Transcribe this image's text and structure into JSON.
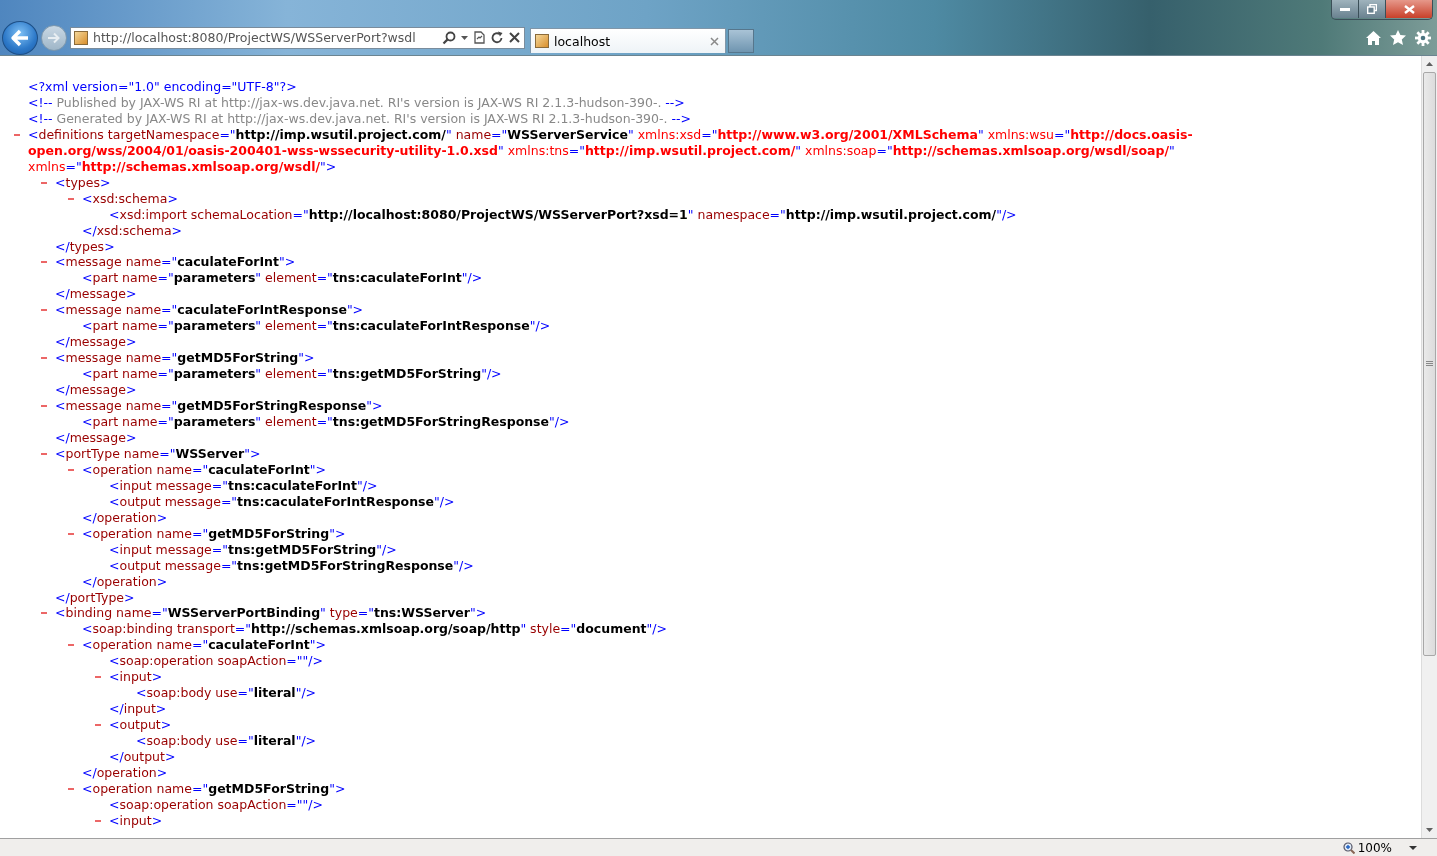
{
  "browser": {
    "address_url": "http://localhost:8080/ProjectWS/WSServerPort?wsdl",
    "tabs": [
      {
        "title": "localhost",
        "selected": true
      }
    ],
    "zoom": "100%"
  },
  "document": [
    {
      "kind": "pi",
      "tokens": [
        {
          "kind": "punct",
          "text": "<?xml version=\"1.0\" encoding=\"UTF-8\"?>"
        }
      ]
    },
    {
      "kind": "comment",
      "tokens": [
        {
          "kind": "punct",
          "text": "<!--"
        },
        {
          "kind": "comment",
          "text": " Published by JAX-WS RI at http://jax-ws.dev.java.net. RI's version is JAX-WS RI 2.1.3-hudson-390-. "
        },
        {
          "kind": "punct",
          "text": "-->"
        }
      ]
    },
    {
      "kind": "comment",
      "tokens": [
        {
          "kind": "punct",
          "text": "<!--"
        },
        {
          "kind": "comment",
          "text": " Generated by JAX-WS RI at http://jax-ws.dev.java.net. RI's version is JAX-WS RI 2.1.3-hudson-390-. "
        },
        {
          "kind": "punct",
          "text": "-->"
        }
      ]
    },
    {
      "kind": "element",
      "expanded": true,
      "tokens": [
        {
          "kind": "punct",
          "text": "<"
        },
        {
          "kind": "tag",
          "text": "definitions"
        },
        {
          "kind": "attr",
          "text": " targetNamespace"
        },
        {
          "kind": "punct",
          "text": "=\""
        },
        {
          "kind": "value",
          "text": "http://imp.wsutil.project.com/"
        },
        {
          "kind": "punct",
          "text": "\""
        },
        {
          "kind": "attr",
          "text": " name"
        },
        {
          "kind": "punct",
          "text": "=\""
        },
        {
          "kind": "value",
          "text": "WSServerService"
        },
        {
          "kind": "punct",
          "text": "\""
        },
        {
          "kind": "nsattr",
          "text": " xmlns:xsd"
        },
        {
          "kind": "punct",
          "text": "=\""
        },
        {
          "kind": "nsvalue",
          "text": "http://www.w3.org/2001/XMLSchema"
        },
        {
          "kind": "punct",
          "text": "\""
        },
        {
          "kind": "nsattr",
          "text": " xmlns:wsu"
        },
        {
          "kind": "punct",
          "text": "=\""
        },
        {
          "kind": "nsvalue",
          "text": "http://docs.oasis-open.org/wss/2004/01/oasis-200401-wss-wssecurity-utility-1.0.xsd"
        },
        {
          "kind": "punct",
          "text": "\""
        },
        {
          "kind": "nsattr",
          "text": " xmlns:tns"
        },
        {
          "kind": "punct",
          "text": "=\""
        },
        {
          "kind": "nsvalue",
          "text": "http://imp.wsutil.project.com/"
        },
        {
          "kind": "punct",
          "text": "\""
        },
        {
          "kind": "nsattr",
          "text": " xmlns:soap"
        },
        {
          "kind": "punct",
          "text": "=\""
        },
        {
          "kind": "nsvalue",
          "text": "http://schemas.xmlsoap.org/wsdl/soap/"
        },
        {
          "kind": "punct",
          "text": "\""
        },
        {
          "kind": "nsattr",
          "text": " xmlns"
        },
        {
          "kind": "punct",
          "text": "=\""
        },
        {
          "kind": "nsvalue",
          "text": "http://schemas.xmlsoap.org/wsdl/"
        },
        {
          "kind": "punct",
          "text": "\">"
        }
      ],
      "children": [
        {
          "kind": "element",
          "expanded": true,
          "tokens": [
            {
              "kind": "punct",
              "text": "<"
            },
            {
              "kind": "tag",
              "text": "types"
            },
            {
              "kind": "punct",
              "text": ">"
            }
          ],
          "children": [
            {
              "kind": "element",
              "expanded": true,
              "tokens": [
                {
                  "kind": "punct",
                  "text": "<"
                },
                {
                  "kind": "tag",
                  "text": "xsd:schema"
                },
                {
                  "kind": "punct",
                  "text": ">"
                }
              ],
              "children": [
                {
                  "kind": "leaf",
                  "tokens": [
                    {
                      "kind": "punct",
                      "text": "<"
                    },
                    {
                      "kind": "tag",
                      "text": "xsd:import"
                    },
                    {
                      "kind": "attr",
                      "text": " schemaLocation"
                    },
                    {
                      "kind": "punct",
                      "text": "=\""
                    },
                    {
                      "kind": "value",
                      "text": "http://localhost:8080/ProjectWS/WSServerPort?xsd=1"
                    },
                    {
                      "kind": "punct",
                      "text": "\""
                    },
                    {
                      "kind": "attr",
                      "text": " namespace"
                    },
                    {
                      "kind": "punct",
                      "text": "=\""
                    },
                    {
                      "kind": "value",
                      "text": "http://imp.wsutil.project.com/"
                    },
                    {
                      "kind": "punct",
                      "text": "\"/>"
                    }
                  ]
                }
              ],
              "end": [
                {
                  "kind": "punct",
                  "text": "</"
                },
                {
                  "kind": "tag",
                  "text": "xsd:schema"
                },
                {
                  "kind": "punct",
                  "text": ">"
                }
              ]
            }
          ],
          "end": [
            {
              "kind": "punct",
              "text": "</"
            },
            {
              "kind": "tag",
              "text": "types"
            },
            {
              "kind": "punct",
              "text": ">"
            }
          ]
        },
        {
          "kind": "element",
          "expanded": true,
          "tokens": [
            {
              "kind": "punct",
              "text": "<"
            },
            {
              "kind": "tag",
              "text": "message"
            },
            {
              "kind": "attr",
              "text": " name"
            },
            {
              "kind": "punct",
              "text": "=\""
            },
            {
              "kind": "value",
              "text": "caculateForInt"
            },
            {
              "kind": "punct",
              "text": "\">"
            }
          ],
          "children": [
            {
              "kind": "leaf",
              "tokens": [
                {
                  "kind": "punct",
                  "text": "<"
                },
                {
                  "kind": "tag",
                  "text": "part"
                },
                {
                  "kind": "attr",
                  "text": " name"
                },
                {
                  "kind": "punct",
                  "text": "=\""
                },
                {
                  "kind": "value",
                  "text": "parameters"
                },
                {
                  "kind": "punct",
                  "text": "\""
                },
                {
                  "kind": "attr",
                  "text": " element"
                },
                {
                  "kind": "punct",
                  "text": "=\""
                },
                {
                  "kind": "value",
                  "text": "tns:caculateForInt"
                },
                {
                  "kind": "punct",
                  "text": "\"/>"
                }
              ]
            }
          ],
          "end": [
            {
              "kind": "punct",
              "text": "</"
            },
            {
              "kind": "tag",
              "text": "message"
            },
            {
              "kind": "punct",
              "text": ">"
            }
          ]
        },
        {
          "kind": "element",
          "expanded": true,
          "tokens": [
            {
              "kind": "punct",
              "text": "<"
            },
            {
              "kind": "tag",
              "text": "message"
            },
            {
              "kind": "attr",
              "text": " name"
            },
            {
              "kind": "punct",
              "text": "=\""
            },
            {
              "kind": "value",
              "text": "caculateForIntResponse"
            },
            {
              "kind": "punct",
              "text": "\">"
            }
          ],
          "children": [
            {
              "kind": "leaf",
              "tokens": [
                {
                  "kind": "punct",
                  "text": "<"
                },
                {
                  "kind": "tag",
                  "text": "part"
                },
                {
                  "kind": "attr",
                  "text": " name"
                },
                {
                  "kind": "punct",
                  "text": "=\""
                },
                {
                  "kind": "value",
                  "text": "parameters"
                },
                {
                  "kind": "punct",
                  "text": "\""
                },
                {
                  "kind": "attr",
                  "text": " element"
                },
                {
                  "kind": "punct",
                  "text": "=\""
                },
                {
                  "kind": "value",
                  "text": "tns:caculateForIntResponse"
                },
                {
                  "kind": "punct",
                  "text": "\"/>"
                }
              ]
            }
          ],
          "end": [
            {
              "kind": "punct",
              "text": "</"
            },
            {
              "kind": "tag",
              "text": "message"
            },
            {
              "kind": "punct",
              "text": ">"
            }
          ]
        },
        {
          "kind": "element",
          "expanded": true,
          "tokens": [
            {
              "kind": "punct",
              "text": "<"
            },
            {
              "kind": "tag",
              "text": "message"
            },
            {
              "kind": "attr",
              "text": " name"
            },
            {
              "kind": "punct",
              "text": "=\""
            },
            {
              "kind": "value",
              "text": "getMD5ForString"
            },
            {
              "kind": "punct",
              "text": "\">"
            }
          ],
          "children": [
            {
              "kind": "leaf",
              "tokens": [
                {
                  "kind": "punct",
                  "text": "<"
                },
                {
                  "kind": "tag",
                  "text": "part"
                },
                {
                  "kind": "attr",
                  "text": " name"
                },
                {
                  "kind": "punct",
                  "text": "=\""
                },
                {
                  "kind": "value",
                  "text": "parameters"
                },
                {
                  "kind": "punct",
                  "text": "\""
                },
                {
                  "kind": "attr",
                  "text": " element"
                },
                {
                  "kind": "punct",
                  "text": "=\""
                },
                {
                  "kind": "value",
                  "text": "tns:getMD5ForString"
                },
                {
                  "kind": "punct",
                  "text": "\"/>"
                }
              ]
            }
          ],
          "end": [
            {
              "kind": "punct",
              "text": "</"
            },
            {
              "kind": "tag",
              "text": "message"
            },
            {
              "kind": "punct",
              "text": ">"
            }
          ]
        },
        {
          "kind": "element",
          "expanded": true,
          "tokens": [
            {
              "kind": "punct",
              "text": "<"
            },
            {
              "kind": "tag",
              "text": "message"
            },
            {
              "kind": "attr",
              "text": " name"
            },
            {
              "kind": "punct",
              "text": "=\""
            },
            {
              "kind": "value",
              "text": "getMD5ForStringResponse"
            },
            {
              "kind": "punct",
              "text": "\">"
            }
          ],
          "children": [
            {
              "kind": "leaf",
              "tokens": [
                {
                  "kind": "punct",
                  "text": "<"
                },
                {
                  "kind": "tag",
                  "text": "part"
                },
                {
                  "kind": "attr",
                  "text": " name"
                },
                {
                  "kind": "punct",
                  "text": "=\""
                },
                {
                  "kind": "value",
                  "text": "parameters"
                },
                {
                  "kind": "punct",
                  "text": "\""
                },
                {
                  "kind": "attr",
                  "text": " element"
                },
                {
                  "kind": "punct",
                  "text": "=\""
                },
                {
                  "kind": "value",
                  "text": "tns:getMD5ForStringResponse"
                },
                {
                  "kind": "punct",
                  "text": "\"/>"
                }
              ]
            }
          ],
          "end": [
            {
              "kind": "punct",
              "text": "</"
            },
            {
              "kind": "tag",
              "text": "message"
            },
            {
              "kind": "punct",
              "text": ">"
            }
          ]
        },
        {
          "kind": "element",
          "expanded": true,
          "tokens": [
            {
              "kind": "punct",
              "text": "<"
            },
            {
              "kind": "tag",
              "text": "portType"
            },
            {
              "kind": "attr",
              "text": " name"
            },
            {
              "kind": "punct",
              "text": "=\""
            },
            {
              "kind": "value",
              "text": "WSServer"
            },
            {
              "kind": "punct",
              "text": "\">"
            }
          ],
          "children": [
            {
              "kind": "element",
              "expanded": true,
              "tokens": [
                {
                  "kind": "punct",
                  "text": "<"
                },
                {
                  "kind": "tag",
                  "text": "operation"
                },
                {
                  "kind": "attr",
                  "text": " name"
                },
                {
                  "kind": "punct",
                  "text": "=\""
                },
                {
                  "kind": "value",
                  "text": "caculateForInt"
                },
                {
                  "kind": "punct",
                  "text": "\">"
                }
              ],
              "children": [
                {
                  "kind": "leaf",
                  "tokens": [
                    {
                      "kind": "punct",
                      "text": "<"
                    },
                    {
                      "kind": "tag",
                      "text": "input"
                    },
                    {
                      "kind": "attr",
                      "text": " message"
                    },
                    {
                      "kind": "punct",
                      "text": "=\""
                    },
                    {
                      "kind": "value",
                      "text": "tns:caculateForInt"
                    },
                    {
                      "kind": "punct",
                      "text": "\"/>"
                    }
                  ]
                },
                {
                  "kind": "leaf",
                  "tokens": [
                    {
                      "kind": "punct",
                      "text": "<"
                    },
                    {
                      "kind": "tag",
                      "text": "output"
                    },
                    {
                      "kind": "attr",
                      "text": " message"
                    },
                    {
                      "kind": "punct",
                      "text": "=\""
                    },
                    {
                      "kind": "value",
                      "text": "tns:caculateForIntResponse"
                    },
                    {
                      "kind": "punct",
                      "text": "\"/>"
                    }
                  ]
                }
              ],
              "end": [
                {
                  "kind": "punct",
                  "text": "</"
                },
                {
                  "kind": "tag",
                  "text": "operation"
                },
                {
                  "kind": "punct",
                  "text": ">"
                }
              ]
            },
            {
              "kind": "element",
              "expanded": true,
              "tokens": [
                {
                  "kind": "punct",
                  "text": "<"
                },
                {
                  "kind": "tag",
                  "text": "operation"
                },
                {
                  "kind": "attr",
                  "text": " name"
                },
                {
                  "kind": "punct",
                  "text": "=\""
                },
                {
                  "kind": "value",
                  "text": "getMD5ForString"
                },
                {
                  "kind": "punct",
                  "text": "\">"
                }
              ],
              "children": [
                {
                  "kind": "leaf",
                  "tokens": [
                    {
                      "kind": "punct",
                      "text": "<"
                    },
                    {
                      "kind": "tag",
                      "text": "input"
                    },
                    {
                      "kind": "attr",
                      "text": " message"
                    },
                    {
                      "kind": "punct",
                      "text": "=\""
                    },
                    {
                      "kind": "value",
                      "text": "tns:getMD5ForString"
                    },
                    {
                      "kind": "punct",
                      "text": "\"/>"
                    }
                  ]
                },
                {
                  "kind": "leaf",
                  "tokens": [
                    {
                      "kind": "punct",
                      "text": "<"
                    },
                    {
                      "kind": "tag",
                      "text": "output"
                    },
                    {
                      "kind": "attr",
                      "text": " message"
                    },
                    {
                      "kind": "punct",
                      "text": "=\""
                    },
                    {
                      "kind": "value",
                      "text": "tns:getMD5ForStringResponse"
                    },
                    {
                      "kind": "punct",
                      "text": "\"/>"
                    }
                  ]
                }
              ],
              "end": [
                {
                  "kind": "punct",
                  "text": "</"
                },
                {
                  "kind": "tag",
                  "text": "operation"
                },
                {
                  "kind": "punct",
                  "text": ">"
                }
              ]
            }
          ],
          "end": [
            {
              "kind": "punct",
              "text": "</"
            },
            {
              "kind": "tag",
              "text": "portType"
            },
            {
              "kind": "punct",
              "text": ">"
            }
          ]
        },
        {
          "kind": "element",
          "expanded": true,
          "tokens": [
            {
              "kind": "punct",
              "text": "<"
            },
            {
              "kind": "tag",
              "text": "binding"
            },
            {
              "kind": "attr",
              "text": " name"
            },
            {
              "kind": "punct",
              "text": "=\""
            },
            {
              "kind": "value",
              "text": "WSServerPortBinding"
            },
            {
              "kind": "punct",
              "text": "\""
            },
            {
              "kind": "attr",
              "text": " type"
            },
            {
              "kind": "punct",
              "text": "=\""
            },
            {
              "kind": "value",
              "text": "tns:WSServer"
            },
            {
              "kind": "punct",
              "text": "\">"
            }
          ],
          "children": [
            {
              "kind": "leaf",
              "tokens": [
                {
                  "kind": "punct",
                  "text": "<"
                },
                {
                  "kind": "tag",
                  "text": "soap:binding"
                },
                {
                  "kind": "attr",
                  "text": " transport"
                },
                {
                  "kind": "punct",
                  "text": "=\""
                },
                {
                  "kind": "value",
                  "text": "http://schemas.xmlsoap.org/soap/http"
                },
                {
                  "kind": "punct",
                  "text": "\""
                },
                {
                  "kind": "attr",
                  "text": " style"
                },
                {
                  "kind": "punct",
                  "text": "=\""
                },
                {
                  "kind": "value",
                  "text": "document"
                },
                {
                  "kind": "punct",
                  "text": "\"/>"
                }
              ]
            },
            {
              "kind": "element",
              "expanded": true,
              "tokens": [
                {
                  "kind": "punct",
                  "text": "<"
                },
                {
                  "kind": "tag",
                  "text": "operation"
                },
                {
                  "kind": "attr",
                  "text": " name"
                },
                {
                  "kind": "punct",
                  "text": "=\""
                },
                {
                  "kind": "value",
                  "text": "caculateForInt"
                },
                {
                  "kind": "punct",
                  "text": "\">"
                }
              ],
              "children": [
                {
                  "kind": "leaf",
                  "tokens": [
                    {
                      "kind": "punct",
                      "text": "<"
                    },
                    {
                      "kind": "tag",
                      "text": "soap:operation"
                    },
                    {
                      "kind": "attr",
                      "text": " soapAction"
                    },
                    {
                      "kind": "punct",
                      "text": "=\"\"/>"
                    }
                  ]
                },
                {
                  "kind": "element",
                  "expanded": true,
                  "tokens": [
                    {
                      "kind": "punct",
                      "text": "<"
                    },
                    {
                      "kind": "tag",
                      "text": "input"
                    },
                    {
                      "kind": "punct",
                      "text": ">"
                    }
                  ],
                  "children": [
                    {
                      "kind": "leaf",
                      "tokens": [
                        {
                          "kind": "punct",
                          "text": "<"
                        },
                        {
                          "kind": "tag",
                          "text": "soap:body"
                        },
                        {
                          "kind": "attr",
                          "text": " use"
                        },
                        {
                          "kind": "punct",
                          "text": "=\""
                        },
                        {
                          "kind": "value",
                          "text": "literal"
                        },
                        {
                          "kind": "punct",
                          "text": "\"/>"
                        }
                      ]
                    }
                  ],
                  "end": [
                    {
                      "kind": "punct",
                      "text": "</"
                    },
                    {
                      "kind": "tag",
                      "text": "input"
                    },
                    {
                      "kind": "punct",
                      "text": ">"
                    }
                  ]
                },
                {
                  "kind": "element",
                  "expanded": true,
                  "tokens": [
                    {
                      "kind": "punct",
                      "text": "<"
                    },
                    {
                      "kind": "tag",
                      "text": "output"
                    },
                    {
                      "kind": "punct",
                      "text": ">"
                    }
                  ],
                  "children": [
                    {
                      "kind": "leaf",
                      "tokens": [
                        {
                          "kind": "punct",
                          "text": "<"
                        },
                        {
                          "kind": "tag",
                          "text": "soap:body"
                        },
                        {
                          "kind": "attr",
                          "text": " use"
                        },
                        {
                          "kind": "punct",
                          "text": "=\""
                        },
                        {
                          "kind": "value",
                          "text": "literal"
                        },
                        {
                          "kind": "punct",
                          "text": "\"/>"
                        }
                      ]
                    }
                  ],
                  "end": [
                    {
                      "kind": "punct",
                      "text": "</"
                    },
                    {
                      "kind": "tag",
                      "text": "output"
                    },
                    {
                      "kind": "punct",
                      "text": ">"
                    }
                  ]
                }
              ],
              "end": [
                {
                  "kind": "punct",
                  "text": "</"
                },
                {
                  "kind": "tag",
                  "text": "operation"
                },
                {
                  "kind": "punct",
                  "text": ">"
                }
              ]
            },
            {
              "kind": "element",
              "expanded": true,
              "tokens": [
                {
                  "kind": "punct",
                  "text": "<"
                },
                {
                  "kind": "tag",
                  "text": "operation"
                },
                {
                  "kind": "attr",
                  "text": " name"
                },
                {
                  "kind": "punct",
                  "text": "=\""
                },
                {
                  "kind": "value",
                  "text": "getMD5ForString"
                },
                {
                  "kind": "punct",
                  "text": "\">"
                }
              ],
              "children": [
                {
                  "kind": "leaf",
                  "tokens": [
                    {
                      "kind": "punct",
                      "text": "<"
                    },
                    {
                      "kind": "tag",
                      "text": "soap:operation"
                    },
                    {
                      "kind": "attr",
                      "text": " soapAction"
                    },
                    {
                      "kind": "punct",
                      "text": "=\"\"/>"
                    }
                  ]
                },
                {
                  "kind": "element",
                  "expanded": true,
                  "tokens": [
                    {
                      "kind": "punct",
                      "text": "<"
                    },
                    {
                      "kind": "tag",
                      "text": "input"
                    },
                    {
                      "kind": "punct",
                      "text": ">"
                    }
                  ]
                }
              ]
            }
          ]
        }
      ]
    }
  ]
}
